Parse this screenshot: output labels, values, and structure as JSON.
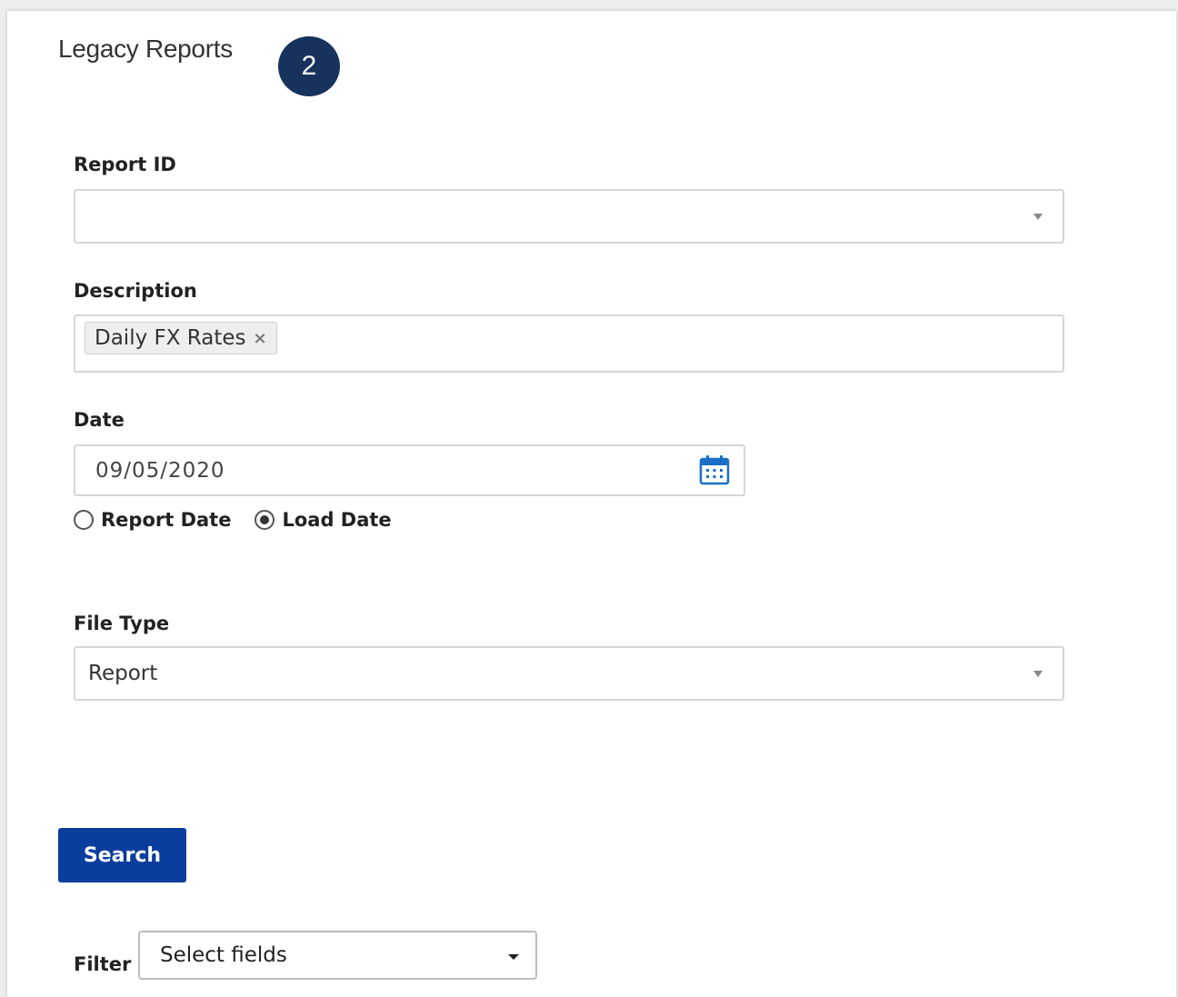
{
  "header": {
    "title": "Legacy Reports",
    "step_badge": "2"
  },
  "form": {
    "report_id": {
      "label": "Report ID",
      "value": ""
    },
    "description": {
      "label": "Description",
      "tags": [
        "Daily FX Rates"
      ],
      "tag_remove_glyph": "×"
    },
    "date": {
      "label": "Date",
      "value": "09/05/2020",
      "icon": "calendar-icon",
      "date_type_options": [
        {
          "label": "Report Date",
          "checked": false
        },
        {
          "label": "Load Date",
          "checked": true
        }
      ]
    },
    "file_type": {
      "label": "File Type",
      "value": "Report"
    },
    "search_label": "Search"
  },
  "filter": {
    "label": "Filter",
    "placeholder": "Select fields"
  },
  "colors": {
    "primary_button": "#0a3e9e",
    "step_badge": "#17325c",
    "calendar_icon": "#1a6fc4"
  }
}
